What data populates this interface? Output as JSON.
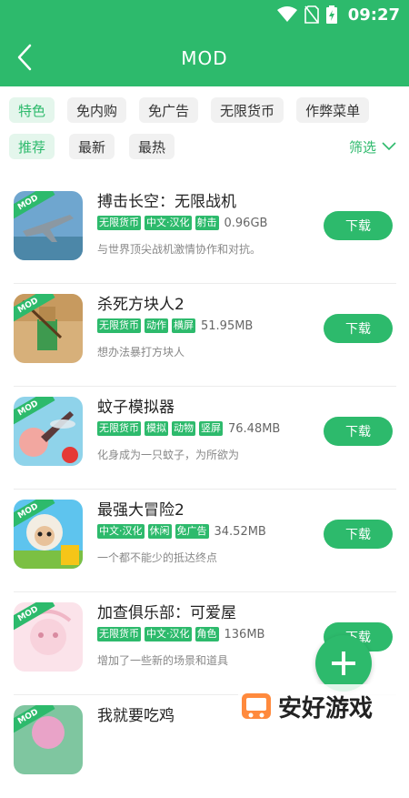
{
  "status_bar": {
    "time": "09:27"
  },
  "header": {
    "title": "MOD"
  },
  "category_chips": [
    {
      "label": "特色",
      "active": true
    },
    {
      "label": "免内购",
      "active": false
    },
    {
      "label": "免广告",
      "active": false
    },
    {
      "label": "无限货币",
      "active": false
    },
    {
      "label": "作弊菜单",
      "active": false
    }
  ],
  "sort_chips": [
    {
      "label": "推荐",
      "active": true
    },
    {
      "label": "最新",
      "active": false
    },
    {
      "label": "最热",
      "active": false
    }
  ],
  "filter_label": "筛选",
  "mod_badge": "MOD",
  "download_label": "下载",
  "games": [
    {
      "name": "搏击长空：无限战机",
      "tags": [
        "无限货币",
        "中文·汉化",
        "射击"
      ],
      "size": "0.96GB",
      "desc": "与世界顶尖战机激情协作和对抗。"
    },
    {
      "name": "杀死方块人2",
      "tags": [
        "无限货币",
        "动作",
        "横屏"
      ],
      "size": "51.95MB",
      "desc": "想办法暴打方块人"
    },
    {
      "name": "蚊子模拟器",
      "tags": [
        "无限货币",
        "模拟",
        "动物",
        "竖屏"
      ],
      "size": "76.48MB",
      "desc": "化身成为一只蚊子，为所欲为"
    },
    {
      "name": "最强大冒险2",
      "tags": [
        "中文·汉化",
        "休闲",
        "免广告"
      ],
      "size": "34.52MB",
      "desc": "一个都不能少的抵达终点"
    },
    {
      "name": "加查俱乐部：可爱屋",
      "tags": [
        "无限货币",
        "中文·汉化",
        "角色"
      ],
      "size": "136MB",
      "desc": "增加了一些新的场景和道具"
    },
    {
      "name": "我就要吃鸡",
      "tags": [],
      "size": "",
      "desc": ""
    }
  ],
  "watermark": {
    "text": "安好游戏"
  },
  "colors": {
    "accent": "#2dba6c"
  }
}
